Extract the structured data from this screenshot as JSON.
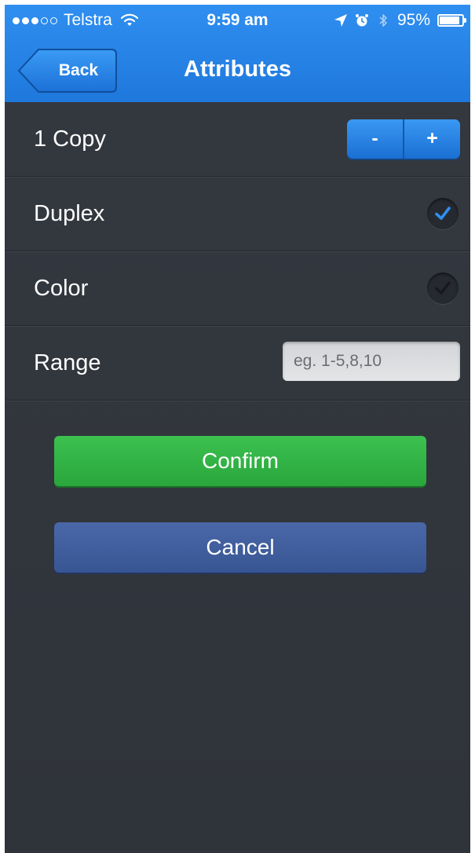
{
  "status_bar": {
    "carrier": "Telstra",
    "time": "9:59 am",
    "battery_percent": "95%",
    "battery_level": 0.95,
    "signal_bars_filled": 3,
    "signal_bars_total": 5,
    "icons": [
      "signal-dots-icon",
      "wifi-icon",
      "location-arrow-icon",
      "alarm-icon",
      "bluetooth-icon",
      "battery-icon"
    ]
  },
  "nav": {
    "back_label": "Back",
    "title": "Attributes"
  },
  "copies": {
    "label": "1 Copy",
    "decrement_label": "-",
    "increment_label": "+"
  },
  "duplex": {
    "label": "Duplex",
    "checked": true
  },
  "color": {
    "label": "Color",
    "checked": false
  },
  "range": {
    "label": "Range",
    "value": "",
    "placeholder": "eg. 1-5,8,10"
  },
  "actions": {
    "confirm_label": "Confirm",
    "cancel_label": "Cancel"
  },
  "colors": {
    "nav_blue": "#2a86e8",
    "background": "#33373e",
    "confirm_green": "#34b748",
    "cancel_blue": "#415f9e",
    "check_active": "#2f8ff0",
    "check_inactive": "#17191d"
  }
}
